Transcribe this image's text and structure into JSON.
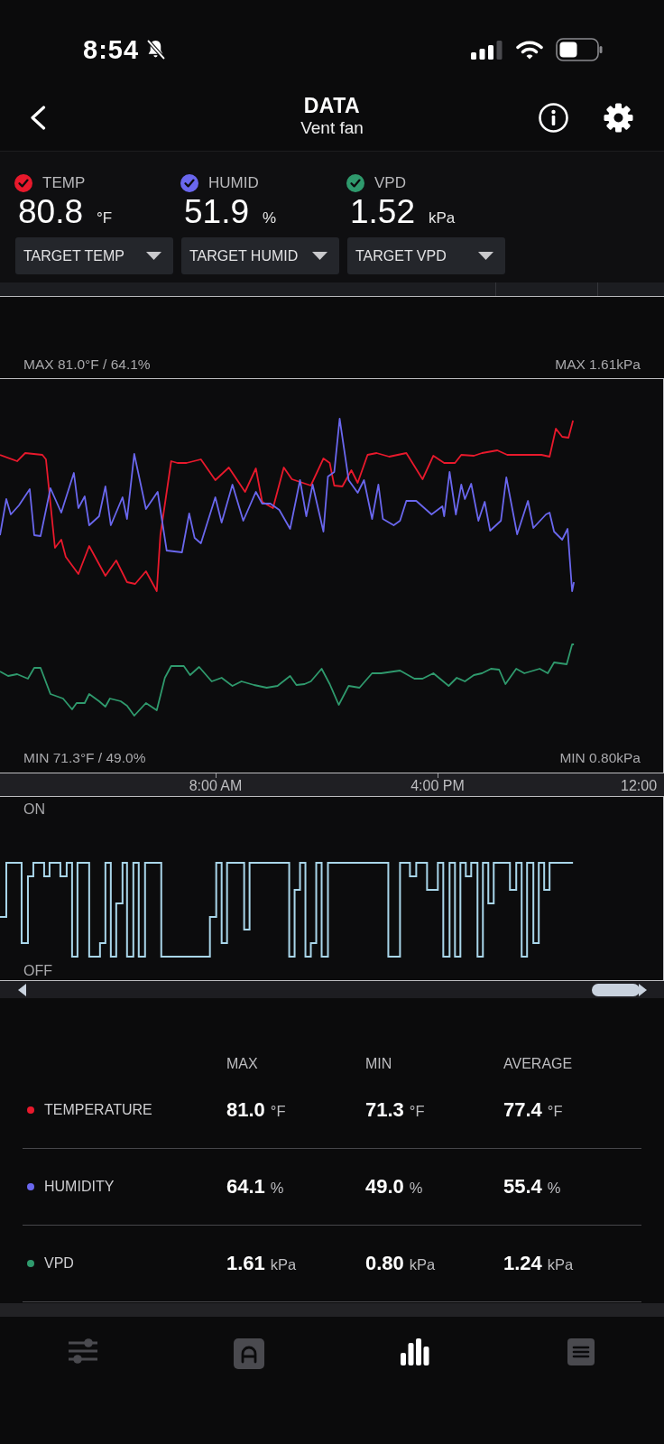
{
  "status_bar": {
    "time": "8:54"
  },
  "header": {
    "title": "DATA",
    "subtitle": "Vent fan"
  },
  "readings": [
    {
      "label": "TEMP",
      "value": "80.8",
      "unit": "°F",
      "checked": true,
      "color": "#e8192c"
    },
    {
      "label": "HUMID",
      "value": "51.9",
      "unit": "%",
      "checked": true,
      "color": "#6a67ee"
    },
    {
      "label": "VPD",
      "value": "1.52",
      "unit": "kPa",
      "checked": true,
      "color": "#2f9a6d"
    }
  ],
  "target_dropdowns": [
    "TARGET TEMP",
    "TARGET HUMID",
    "TARGET VPD"
  ],
  "chart": {
    "max_left": "MAX 81.0°F / 64.1%",
    "max_right": "MAX 1.61kPa",
    "min_left": "MIN 71.3°F / 49.0%",
    "min_right": "MIN 0.80kPa",
    "time_labels": [
      "8:00 AM",
      "4:00 PM",
      "12:00"
    ]
  },
  "fan_chart": {
    "on_label": "ON",
    "off_label": "OFF"
  },
  "stats": {
    "columns": [
      "MAX",
      "MIN",
      "AVERAGE"
    ],
    "rows": [
      {
        "name": "TEMPERATURE",
        "color": "#e8192c",
        "cells": [
          {
            "value": "81.0",
            "unit": "°F"
          },
          {
            "value": "71.3",
            "unit": "°F"
          },
          {
            "value": "77.4",
            "unit": "°F"
          }
        ]
      },
      {
        "name": "HUMIDITY",
        "color": "#6a67ee",
        "cells": [
          {
            "value": "64.1",
            "unit": "%"
          },
          {
            "value": "49.0",
            "unit": "%"
          },
          {
            "value": "55.4",
            "unit": "%"
          }
        ]
      },
      {
        "name": "VPD",
        "color": "#2f9a6d",
        "cells": [
          {
            "value": "1.61",
            "unit": "kPa"
          },
          {
            "value": "0.80",
            "unit": "kPa"
          },
          {
            "value": "1.24",
            "unit": "kPa"
          }
        ]
      }
    ]
  },
  "nav": [
    {
      "kind": "sliders",
      "selected": false
    },
    {
      "kind": "auto",
      "selected": false
    },
    {
      "kind": "chart",
      "selected": true
    },
    {
      "kind": "list",
      "selected": false
    }
  ]
}
